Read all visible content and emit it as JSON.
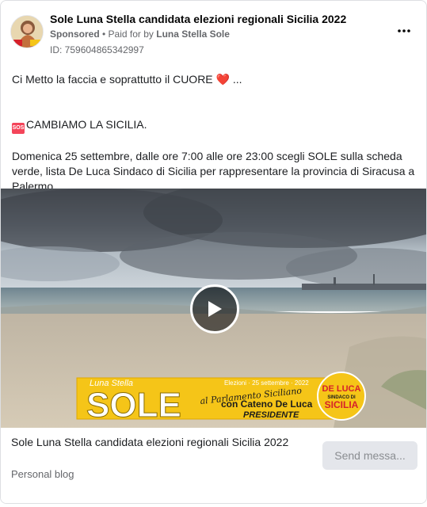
{
  "header": {
    "page_name": "Sole Luna Stella candidata elezioni regionali Sicilia 2022",
    "sponsored_label": "Sponsored",
    "separator": " • ",
    "paid_for_prefix": "Paid for by ",
    "paid_for_name": "Luna Stella Sole",
    "ad_id": "ID: 759604865342997",
    "more_icon": "more-horizontal-icon"
  },
  "post": {
    "line1": "Ci Metto la faccia e soprattutto il CUORE ",
    "line1_emoji": "❤️",
    "line1_suffix": " ...",
    "sos_emoji": "SOS",
    "line2": "CAMBIAMO LA SICILIA.",
    "line3": "Domenica 25 settembre, dalle ore 7:00 alle ore 23:00 scegli SOLE sulla scheda verde, lista De Luca Sindaco di Sicilia per rappresentare la provincia di Siracusa a Palermo ...."
  },
  "media": {
    "banner_top_name": "Luna Stella",
    "banner_main_name": "SOLE",
    "banner_date": "Elezioni · 25 settembre · 2022",
    "banner_tagline": "al Parlamento Siciliano",
    "banner_with": "con Cateno De Luca",
    "banner_role": "PRESIDENTE",
    "logo_top": "DE LUCA",
    "logo_mid": "SINDACO DI",
    "logo_bottom": "SICILIA",
    "play_icon": "play-icon"
  },
  "footer": {
    "title": "Sole Luna Stella candidata elezioni regionali Sicilia 2022",
    "category": "Personal blog",
    "cta_label": "Send messa..."
  },
  "colors": {
    "banner_yellow": "#f5c518",
    "logo_red": "#d6202a",
    "cta_bg": "#e4e6eb"
  }
}
